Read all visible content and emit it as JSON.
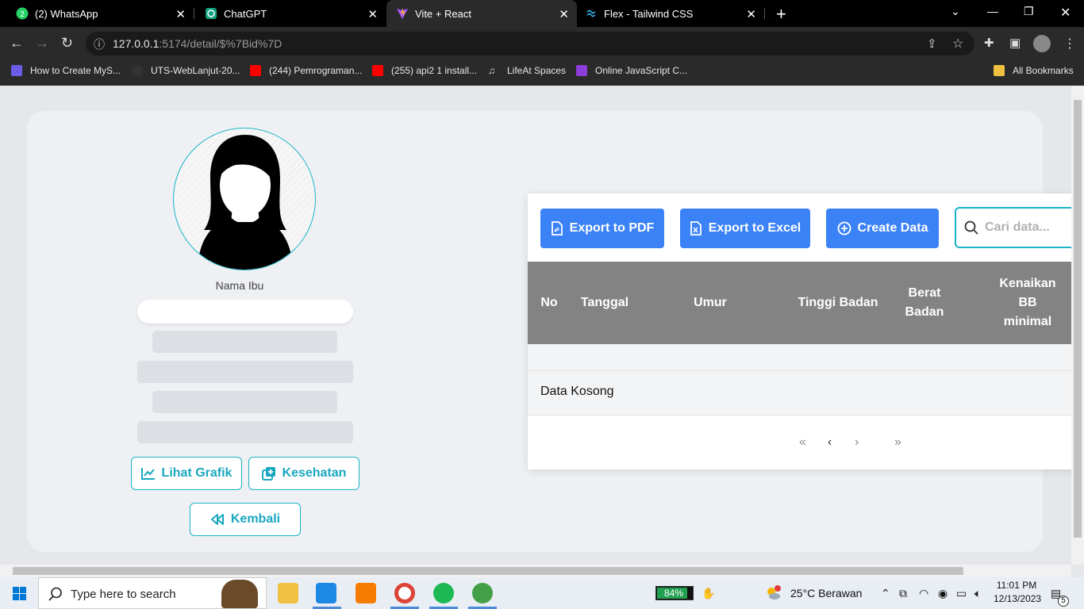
{
  "browser": {
    "tabs": [
      {
        "title": "(2) WhatsApp",
        "icon": "whatsapp-icon"
      },
      {
        "title": "ChatGPT",
        "icon": "chatgpt-icon"
      },
      {
        "title": "Vite + React",
        "icon": "vite-icon",
        "active": true
      },
      {
        "title": "Flex - Tailwind CSS",
        "icon": "tailwind-icon"
      }
    ],
    "url_host": "127.0.0.1",
    "url_path": ":5174/detail/$%7Bid%7D",
    "bookmarks": [
      "How to Create MyS...",
      "UTS-WebLanjut-20...",
      "(244) Pemrograman...",
      "(255) api2 1 install...",
      "LifeAt Spaces",
      "Online JavaScript C..."
    ],
    "all_bookmarks": "All Bookmarks"
  },
  "profile": {
    "name_label": "Nama Ibu",
    "buttons": {
      "lihat_grafik": "Lihat Grafik",
      "kesehatan": "Kesehatan",
      "kembali": "Kembali"
    }
  },
  "toolbar": {
    "export_pdf": "Export to PDF",
    "export_excel": "Export to Excel",
    "create_data": "Create Data",
    "search_placeholder": "Cari data..."
  },
  "table": {
    "headers": [
      "No",
      "Tanggal",
      "Umur",
      "Tinggi Badan",
      "Berat Badan",
      "Kenaikan BB minimal"
    ],
    "empty_text": "Data Kosong",
    "pagination": [
      "«",
      "‹",
      "›",
      "»"
    ]
  },
  "taskbar": {
    "search_text": "Type here to search",
    "battery": "84%",
    "weather": "25°C  Berawan",
    "time": "11:01 PM",
    "date": "12/13/2023",
    "notifications": "5"
  },
  "colors": {
    "accent_blue": "#3b82f6",
    "accent_teal": "#19b4c8",
    "table_header": "#838383"
  }
}
